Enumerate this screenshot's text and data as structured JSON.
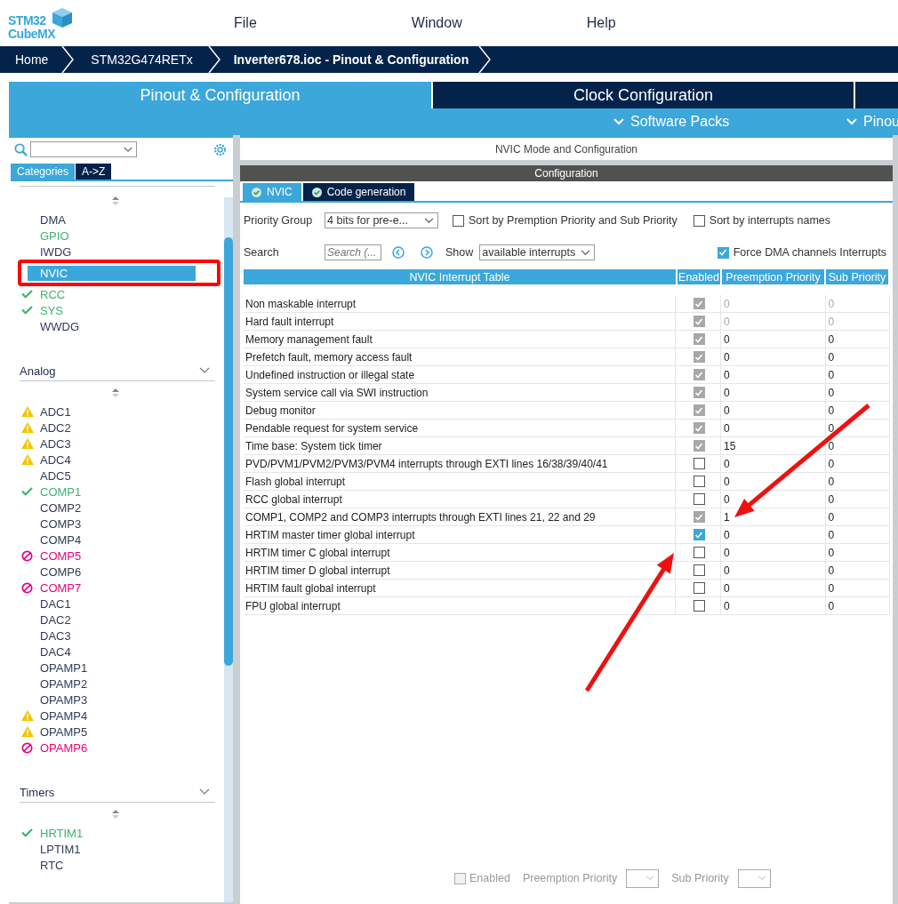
{
  "logo": {
    "line1": "STM32",
    "line2": "CubeMX"
  },
  "menu": [
    "File",
    "Window",
    "Help"
  ],
  "breadcrumb": [
    "Home",
    "STM32G474RETx",
    "Inverter678.ioc - Pinout & Configuration"
  ],
  "tabs": [
    {
      "label": "Pinout & Configuration",
      "selected": true
    },
    {
      "label": "Clock Configuration",
      "selected": false
    }
  ],
  "subtabs": [
    "Software Packs",
    "Pinou"
  ],
  "sidebar": {
    "categories_tabs": [
      {
        "label": "Categories",
        "selected": true
      },
      {
        "label": "A->Z",
        "selected": false
      }
    ],
    "groups": [
      {
        "items": [
          {
            "label": "DMA",
            "kind": "none",
            "selected": false
          },
          {
            "label": "GPIO",
            "kind": "configured",
            "selected": false
          },
          {
            "label": "IWDG",
            "kind": "none",
            "selected": false
          },
          {
            "label": "NVIC",
            "kind": "none",
            "selected": true
          },
          {
            "label": "RCC",
            "kind": "ok",
            "selected": false
          },
          {
            "label": "SYS",
            "kind": "ok",
            "selected": false
          },
          {
            "label": "WWDG",
            "kind": "none",
            "selected": false
          }
        ]
      },
      {
        "title": "Analog",
        "items": [
          {
            "label": "ADC1",
            "kind": "warning",
            "selected": false
          },
          {
            "label": "ADC2",
            "kind": "warning",
            "selected": false
          },
          {
            "label": "ADC3",
            "kind": "warning",
            "selected": false
          },
          {
            "label": "ADC4",
            "kind": "warning",
            "selected": false
          },
          {
            "label": "ADC5",
            "kind": "none",
            "selected": false
          },
          {
            "label": "COMP1",
            "kind": "ok",
            "selected": false
          },
          {
            "label": "COMP2",
            "kind": "none",
            "selected": false
          },
          {
            "label": "COMP3",
            "kind": "none",
            "selected": false
          },
          {
            "label": "COMP4",
            "kind": "none",
            "selected": false
          },
          {
            "label": "COMP5",
            "kind": "error",
            "selected": false
          },
          {
            "label": "COMP6",
            "kind": "none",
            "selected": false
          },
          {
            "label": "COMP7",
            "kind": "error",
            "selected": false
          },
          {
            "label": "DAC1",
            "kind": "none",
            "selected": false
          },
          {
            "label": "DAC2",
            "kind": "none",
            "selected": false
          },
          {
            "label": "DAC3",
            "kind": "none",
            "selected": false
          },
          {
            "label": "DAC4",
            "kind": "none",
            "selected": false
          },
          {
            "label": "OPAMP1",
            "kind": "none",
            "selected": false
          },
          {
            "label": "OPAMP2",
            "kind": "none",
            "selected": false
          },
          {
            "label": "OPAMP3",
            "kind": "none",
            "selected": false
          },
          {
            "label": "OPAMP4",
            "kind": "warning",
            "selected": false
          },
          {
            "label": "OPAMP5",
            "kind": "warning",
            "selected": false
          },
          {
            "label": "OPAMP6",
            "kind": "error",
            "selected": false
          }
        ]
      },
      {
        "title": "Timers",
        "items": [
          {
            "label": "HRTIM1",
            "kind": "ok",
            "selected": false
          },
          {
            "label": "LPTIM1",
            "kind": "none",
            "selected": false
          },
          {
            "label": "RTC",
            "kind": "none",
            "selected": false
          }
        ]
      }
    ]
  },
  "panel": {
    "title": "NVIC Mode and Configuration",
    "section": "Configuration",
    "tabs": [
      {
        "label": "NVIC",
        "selected": true
      },
      {
        "label": "Code generation",
        "selected": false
      }
    ],
    "priority_group": {
      "label": "Priority Group",
      "value": "4 bits for pre-e..."
    },
    "sort_by_priority": {
      "label": "Sort by Premption Priority and Sub Priority",
      "checked": false
    },
    "sort_by_names": {
      "label": "Sort by interrupts names",
      "checked": false
    },
    "search": {
      "label": "Search",
      "placeholder": "Search (..."
    },
    "show": {
      "label": "Show",
      "value": "available interrupts"
    },
    "force_dma": {
      "label": "Force DMA channels Interrupts",
      "checked": true
    },
    "table": {
      "columns": [
        "NVIC Interrupt Table",
        "Enabled",
        "Preemption Priority",
        "Sub Priority"
      ],
      "rows": [
        {
          "name": "Non maskable interrupt",
          "checked": true,
          "disabled": true,
          "priority_disabled": true,
          "preemption": "0",
          "sub": "0"
        },
        {
          "name": "Hard fault interrupt",
          "checked": true,
          "disabled": true,
          "priority_disabled": true,
          "preemption": "0",
          "sub": "0"
        },
        {
          "name": "Memory management fault",
          "checked": true,
          "disabled": true,
          "priority_disabled": false,
          "preemption": "0",
          "sub": "0"
        },
        {
          "name": "Prefetch fault, memory access fault",
          "checked": true,
          "disabled": true,
          "priority_disabled": false,
          "preemption": "0",
          "sub": "0"
        },
        {
          "name": "Undefined instruction or illegal state",
          "checked": true,
          "disabled": true,
          "priority_disabled": false,
          "preemption": "0",
          "sub": "0"
        },
        {
          "name": "System service call via SWI instruction",
          "checked": true,
          "disabled": true,
          "priority_disabled": false,
          "preemption": "0",
          "sub": "0"
        },
        {
          "name": "Debug monitor",
          "checked": true,
          "disabled": true,
          "priority_disabled": false,
          "preemption": "0",
          "sub": "0"
        },
        {
          "name": "Pendable request for system service",
          "checked": true,
          "disabled": true,
          "priority_disabled": false,
          "preemption": "0",
          "sub": "0"
        },
        {
          "name": "Time base: System tick timer",
          "checked": true,
          "disabled": true,
          "priority_disabled": false,
          "preemption": "15",
          "sub": "0"
        },
        {
          "name": "PVD/PVM1/PVM2/PVM3/PVM4 interrupts through EXTI lines 16/38/39/40/41",
          "checked": false,
          "disabled": false,
          "priority_disabled": false,
          "preemption": "0",
          "sub": "0"
        },
        {
          "name": "Flash global interrupt",
          "checked": false,
          "disabled": false,
          "priority_disabled": false,
          "preemption": "0",
          "sub": "0"
        },
        {
          "name": "RCC global interrupt",
          "checked": false,
          "disabled": false,
          "priority_disabled": false,
          "preemption": "0",
          "sub": "0"
        },
        {
          "name": "COMP1, COMP2 and COMP3 interrupts through EXTI lines 21, 22 and 29",
          "checked": true,
          "disabled": true,
          "priority_disabled": false,
          "preemption": "1",
          "sub": "0"
        },
        {
          "name": "HRTIM master timer global interrupt",
          "checked": true,
          "disabled": false,
          "priority_disabled": false,
          "preemption": "0",
          "sub": "0"
        },
        {
          "name": "HRTIM timer C global interrupt",
          "checked": false,
          "disabled": false,
          "priority_disabled": false,
          "preemption": "0",
          "sub": "0"
        },
        {
          "name": "HRTIM timer D global interrupt",
          "checked": false,
          "disabled": false,
          "priority_disabled": false,
          "preemption": "0",
          "sub": "0"
        },
        {
          "name": "HRTIM fault global interrupt",
          "checked": false,
          "disabled": false,
          "priority_disabled": false,
          "preemption": "0",
          "sub": "0"
        },
        {
          "name": "FPU global interrupt",
          "checked": false,
          "disabled": false,
          "priority_disabled": false,
          "preemption": "0",
          "sub": "0"
        }
      ]
    },
    "footer": {
      "enabled": {
        "label": "Enabled",
        "checked": false
      },
      "preemption_label": "Preemption Priority",
      "sub_label": "Sub Priority"
    }
  }
}
